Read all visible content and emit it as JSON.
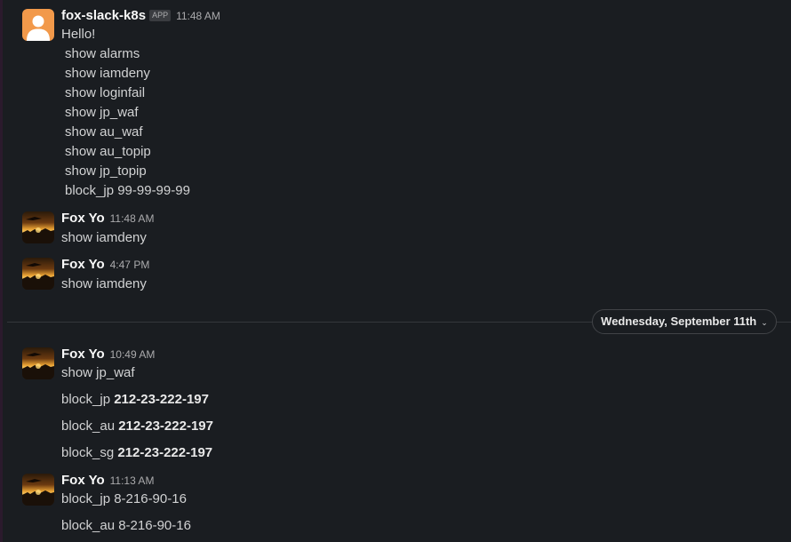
{
  "messages": [
    {
      "sender": "fox-slack-k8s",
      "badge": "APP",
      "time": "11:48 AM",
      "greeting": "Hello!",
      "commands": [
        "show alarms",
        "show iamdeny",
        "show loginfail",
        "show jp_waf",
        "show au_waf",
        "show au_topip",
        "show jp_topip",
        "block_jp 99-99-99-99"
      ]
    },
    {
      "sender": "Fox Yo",
      "time": "11:48 AM",
      "text": "show iamdeny"
    },
    {
      "sender": "Fox Yo",
      "time": "4:47 PM",
      "text": "show iamdeny"
    },
    {
      "sender": "Fox Yo",
      "time": "10:49 AM",
      "text": "show jp_waf",
      "blocks": [
        {
          "cmd": "block_jp",
          "ip": "212-23-222-197"
        },
        {
          "cmd": "block_au",
          "ip": "212-23-222-197"
        },
        {
          "cmd": "block_sg",
          "ip": "212-23-222-197"
        }
      ]
    },
    {
      "sender": "Fox Yo",
      "time": "11:13 AM",
      "lines": [
        "block_jp 8-216-90-16",
        "block_au 8-216-90-16"
      ]
    }
  ],
  "date_divider": {
    "label": "Wednesday, September 11th",
    "chevron": "⌄"
  },
  "icons": {
    "app_avatar": "user-silhouette-icon",
    "user_avatar": "sunset-photo-avatar"
  }
}
